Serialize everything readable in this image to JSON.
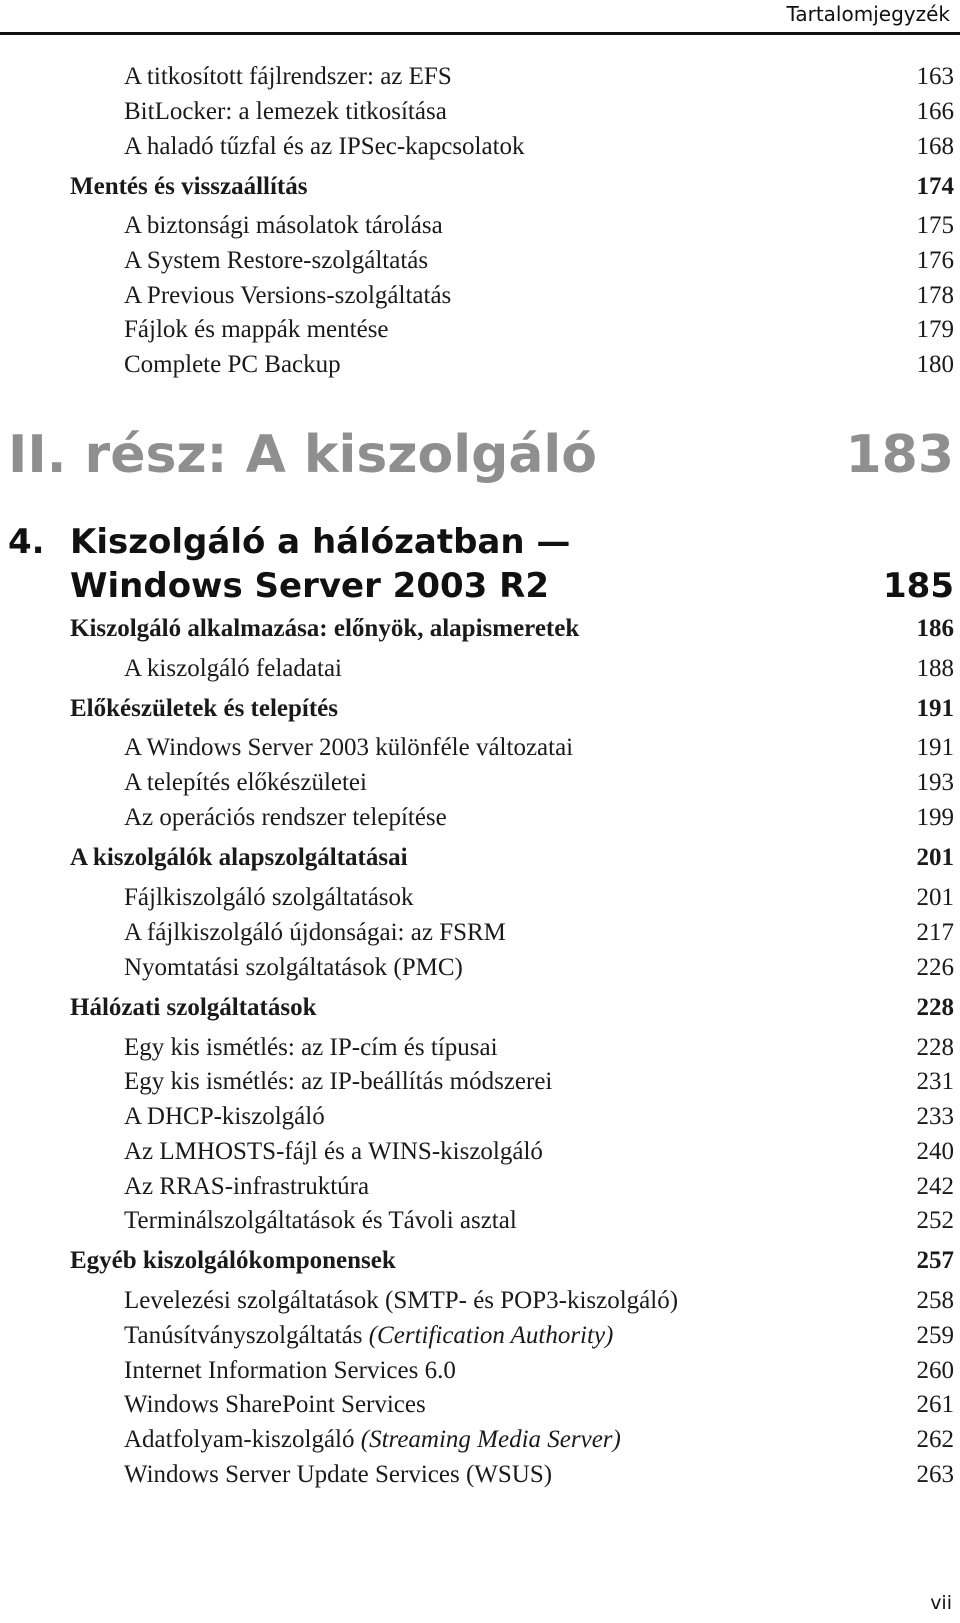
{
  "running_head": "Tartalomjegyzék",
  "folio": "vii",
  "continued_entries": [
    {
      "title": "A titkosított fájlrendszer: az EFS",
      "page": "163",
      "level": 2
    },
    {
      "title": "BitLocker: a lemezek titkosítása",
      "page": "166",
      "level": 2
    },
    {
      "title": "A haladó tűzfal és az IPSec-kapcsolatok",
      "page": "168",
      "level": 2
    },
    {
      "title": "Mentés és visszaállítás",
      "page": "174",
      "level": 1
    },
    {
      "title": "A biztonsági másolatok tárolása",
      "page": "175",
      "level": 2
    },
    {
      "title": "A System Restore-szolgáltatás",
      "page": "176",
      "level": 2
    },
    {
      "title": "A Previous Versions-szolgáltatás",
      "page": "178",
      "level": 2
    },
    {
      "title": "Fájlok és mappák mentése",
      "page": "179",
      "level": 2
    },
    {
      "title": "Complete PC Backup",
      "page": "180",
      "level": 2
    }
  ],
  "part": {
    "title": "II. rész: A kiszolgáló",
    "page": "183"
  },
  "chapter": {
    "number": "4.",
    "title_line1": "Kiszolgáló a hálózatban —",
    "title_line2": "Windows Server 2003 R2",
    "page": "185"
  },
  "chapter_entries": [
    {
      "title": "Kiszolgáló alkalmazása: előnyök, alapismeretek",
      "page": "186",
      "level": 1
    },
    {
      "title": "A kiszolgáló feladatai",
      "page": "188",
      "level": 2
    },
    {
      "title": "Előkészületek és telepítés",
      "page": "191",
      "level": 1
    },
    {
      "title": "A Windows Server 2003 különféle változatai",
      "page": "191",
      "level": 2
    },
    {
      "title": "A telepítés előkészületei",
      "page": "193",
      "level": 2
    },
    {
      "title": "Az operációs rendszer telepítése",
      "page": "199",
      "level": 2
    },
    {
      "title": "A kiszolgálók alapszolgáltatásai",
      "page": "201",
      "level": 1
    },
    {
      "title": "Fájlkiszolgáló szolgáltatások",
      "page": "201",
      "level": 2
    },
    {
      "title": "A fájlkiszolgáló újdonságai: az FSRM",
      "page": "217",
      "level": 2
    },
    {
      "title": "Nyomtatási szolgáltatások (PMC)",
      "page": "226",
      "level": 2
    },
    {
      "title": "Hálózati szolgáltatások",
      "page": "228",
      "level": 1
    },
    {
      "title": "Egy kis ismétlés: az IP-cím és típusai",
      "page": "228",
      "level": 2
    },
    {
      "title": "Egy kis ismétlés: az IP-beállítás módszerei",
      "page": "231",
      "level": 2
    },
    {
      "title": "A DHCP-kiszolgáló",
      "page": "233",
      "level": 2
    },
    {
      "title": "Az LMHOSTS-fájl és a WINS-kiszolgáló",
      "page": "240",
      "level": 2
    },
    {
      "title": "Az RRAS-infrastruktúra",
      "page": "242",
      "level": 2
    },
    {
      "title": "Terminálszolgáltatások és Távoli asztal",
      "page": "252",
      "level": 2
    },
    {
      "title": "Egyéb kiszolgálókomponensek",
      "page": "257",
      "level": 1
    },
    {
      "title": "Levelezési szolgáltatások (SMTP- és POP3-kiszolgáló)",
      "page": "258",
      "level": 2
    },
    {
      "title": "Tanúsítványszolgáltatás",
      "title_italic": "(Certification Authority)",
      "page": "259",
      "level": 2
    },
    {
      "title": "Internet Information Services 6.0",
      "page": "260",
      "level": 2
    },
    {
      "title": "Windows SharePoint Services",
      "page": "261",
      "level": 2
    },
    {
      "title": "Adatfolyam-kiszolgáló",
      "title_italic": "(Streaming Media Server)",
      "page": "262",
      "level": 2
    },
    {
      "title": "Windows Server Update Services (WSUS)",
      "page": "263",
      "level": 2
    }
  ]
}
